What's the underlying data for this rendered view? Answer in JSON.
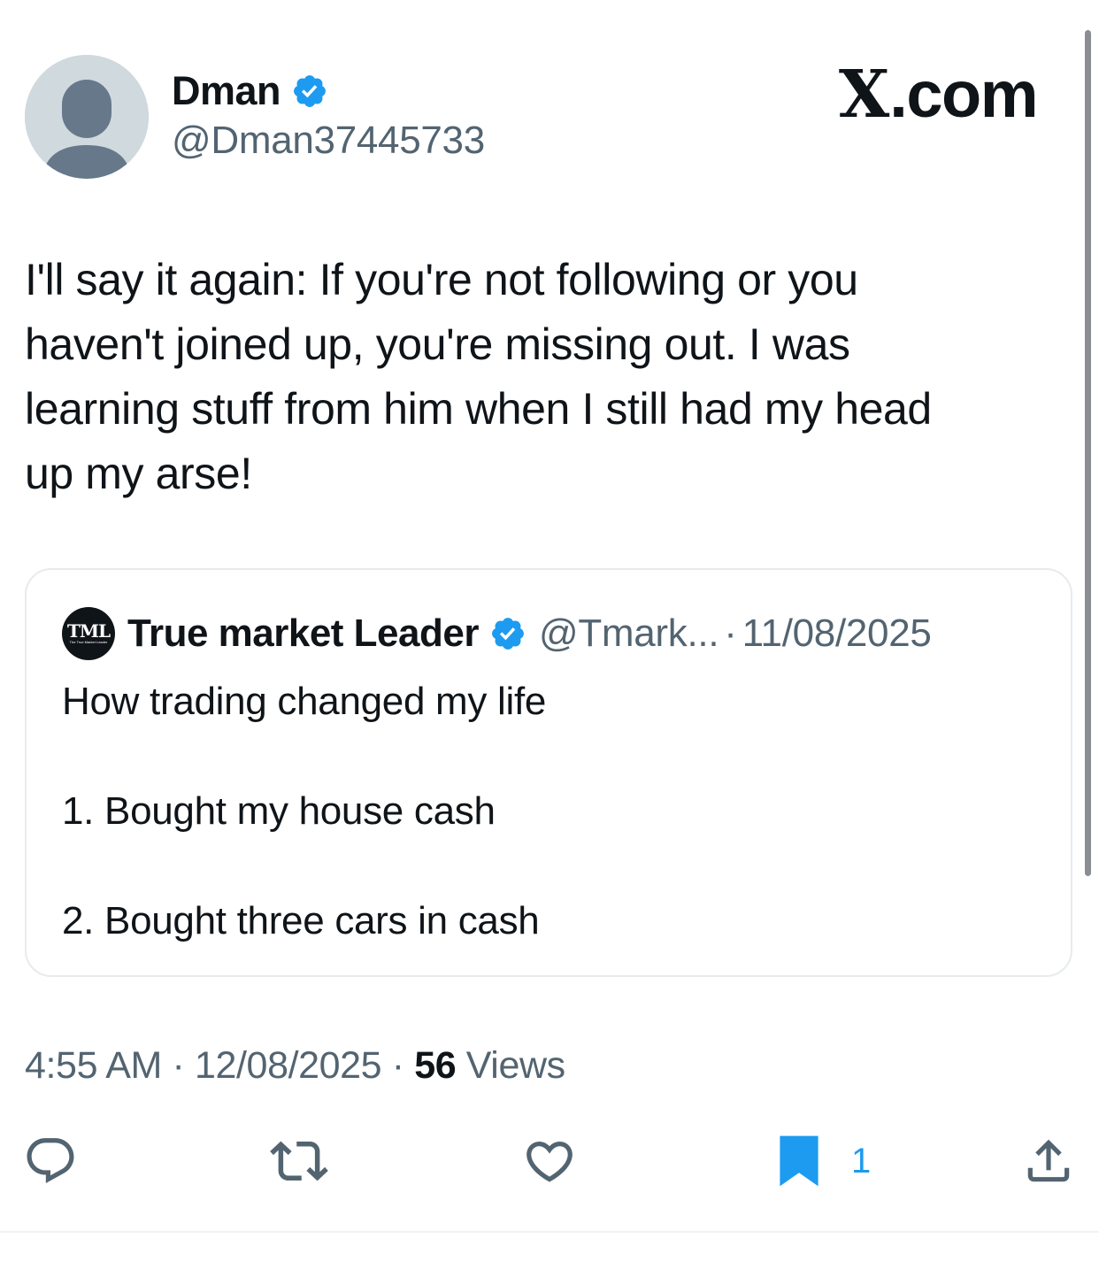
{
  "author": {
    "name": "Dman",
    "handle": "@Dman37445733",
    "verified": true
  },
  "brand": {
    "logo_letter": "X",
    "suffix": ".com"
  },
  "tweet": {
    "text": "I'll say it again: If you're not following or you\nhaven't joined up, you're missing out. I was\nlearning stuff from him when I still had my head\nup my arse!"
  },
  "quoted_tweet": {
    "logo_text": "TML",
    "logo_subtext": "The True Market Leader",
    "name": "True market Leader",
    "handle": "@Tmark...",
    "separator": "·",
    "date": "11/08/2025",
    "text": "How trading changed my life\n\n1. Bought my house cash\n\n2. Bought three cars in cash"
  },
  "meta": {
    "time": "4:55 AM",
    "separator": "·",
    "date": "12/08/2025",
    "views_count": "56",
    "views_label": "Views"
  },
  "actions": {
    "reply_icon": "reply-icon",
    "repost_icon": "repost-icon",
    "like_icon": "heart-icon",
    "bookmark_icon": "bookmark-icon",
    "bookmark_count": "1",
    "share_icon": "share-icon"
  },
  "colors": {
    "accent": "#1d9bf0",
    "text": "#0f1419",
    "secondary": "#536471"
  }
}
